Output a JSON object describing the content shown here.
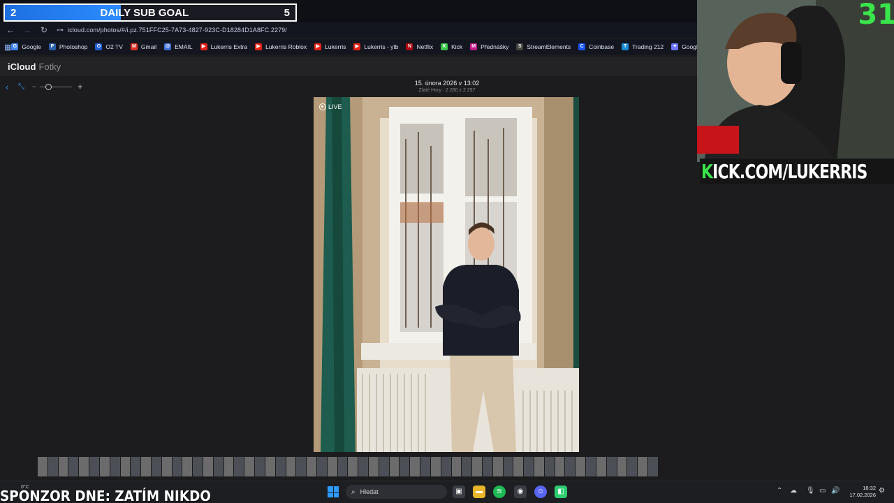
{
  "overlay": {
    "subgoal": {
      "current": "2",
      "title": "DAILY SUB GOAL",
      "target": "5",
      "progress": 0.4
    },
    "webcam_counter": "31",
    "kick_banner": {
      "k": "K",
      "rest": "ICK.COM/LUKERRIS"
    },
    "sponsor": "SPONZOR DNE: ZATÍM NIKDO"
  },
  "browser": {
    "url": "icloud.com/photos/#/i.pz.751FFC25-7A73-4827-923C-D18284D1A8FC.2279/",
    "bookmarks": [
      {
        "label": "Google",
        "icon": "google-icon",
        "color": "#4285f4",
        "glyph": "G"
      },
      {
        "label": "Photoshop",
        "icon": "photoshop-icon",
        "color": "#2b5fa8",
        "glyph": "P"
      },
      {
        "label": "O2 TV",
        "icon": "o2tv-icon",
        "color": "#1e5fcf",
        "glyph": "O"
      },
      {
        "label": "Gmail",
        "icon": "gmail-icon",
        "color": "#d93025",
        "glyph": "M"
      },
      {
        "label": "EMAIL",
        "icon": "email-icon",
        "color": "#3b6fd6",
        "glyph": "@"
      },
      {
        "label": "Lukerris Extra",
        "icon": "youtube-icon",
        "color": "#e62117",
        "glyph": "▶"
      },
      {
        "label": "Lukerris Roblox",
        "icon": "youtube-icon",
        "color": "#e62117",
        "glyph": "▶"
      },
      {
        "label": "Lukerris",
        "icon": "youtube-icon",
        "color": "#e62117",
        "glyph": "▶"
      },
      {
        "label": "Lukerris - ytb",
        "icon": "youtube-studio-icon",
        "color": "#e62117",
        "glyph": "▶"
      },
      {
        "label": "Netflix",
        "icon": "netflix-icon",
        "color": "#b20710",
        "glyph": "N"
      },
      {
        "label": "Kick",
        "icon": "kick-icon",
        "color": "#39c54b",
        "glyph": "K"
      },
      {
        "label": "Přednášky",
        "icon": "lectures-icon",
        "color": "#c2188a",
        "glyph": "M"
      },
      {
        "label": "StreamElements",
        "icon": "streamelements-icon",
        "color": "#444",
        "glyph": "S"
      },
      {
        "label": "Coinbase",
        "icon": "coinbase-icon",
        "color": "#1652f0",
        "glyph": "C"
      },
      {
        "label": "Trading 212",
        "icon": "trading212-icon",
        "color": "#1a8bd6",
        "glyph": "T"
      },
      {
        "label": "Google Gem",
        "icon": "gemini-icon",
        "color": "#6b73ff",
        "glyph": "✦"
      }
    ]
  },
  "icloud": {
    "brand": "iCloud",
    "app": "Fotky",
    "photo_date": "15. února 2026 v 13:02",
    "photo_sub": "Zlaté Hory · 2 280 z 2 297",
    "live_label": "LIVE"
  },
  "taskbar": {
    "weather": "0°C",
    "search_placeholder": "Hledat",
    "time": "18:32",
    "date": "17.02.2026"
  }
}
